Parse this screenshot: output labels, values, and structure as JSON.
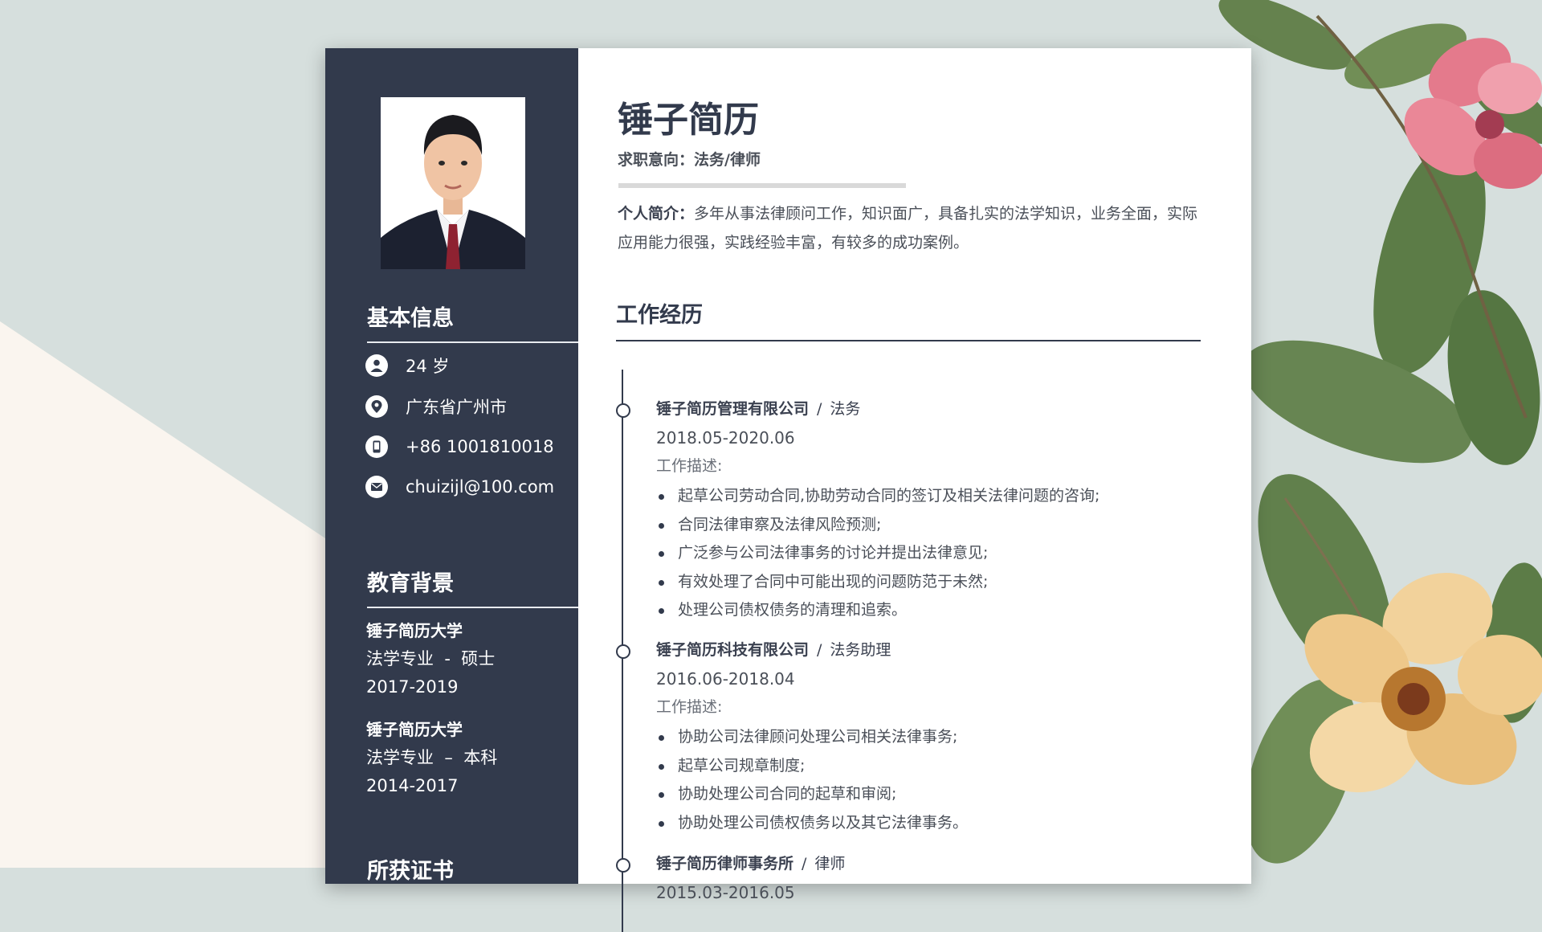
{
  "profile": {
    "name": "锤子简历",
    "intention": "求职意向：法务/律师",
    "summary_label": "个人简介：",
    "summary_text": "多年从事法律顾问工作，知识面广，具备扎实的法学知识，业务全面，实际应用能力很强，实践经验丰富，有较多的成功案例。"
  },
  "sidebar": {
    "basic_heading": "基本信息",
    "basic": [
      {
        "icon": "user-icon",
        "text": "24 岁"
      },
      {
        "icon": "location-pin-icon",
        "text": "广东省广州市"
      },
      {
        "icon": "phone-icon",
        "text": "+86 1001810018"
      },
      {
        "icon": "mail-icon",
        "text": "chuizijl@100.com"
      }
    ],
    "education_heading": "教育背景",
    "education": [
      {
        "school": "锤子简历大学",
        "major": "法学专业  -  硕士",
        "years": "2017-2019"
      },
      {
        "school": "锤子简历大学",
        "major": "法学专业  –  本科",
        "years": "2014-2017"
      }
    ],
    "certificates_heading": "所获证书"
  },
  "work": {
    "heading": "工作经历",
    "jobs": [
      {
        "company": "锤子简历管理有限公司",
        "role": "法务",
        "period": "2018.05-2020.06",
        "desc_label": "工作描述:",
        "bullets": [
          "起草公司劳动合同,协助劳动合同的签订及相关法律问题的咨询;",
          "合同法律审察及法律风险预测;",
          "广泛参与公司法律事务的讨论并提出法律意见;",
          "有效处理了合同中可能出现的问题防范于未然;",
          "处理公司债权债务的清理和追索。"
        ]
      },
      {
        "company": "锤子简历科技有限公司",
        "role": "法务助理",
        "period": "2016.06-2018.04",
        "desc_label": "工作描述:",
        "bullets": [
          "协助公司法律顾问处理公司相关法律事务;",
          "起草公司规章制度;",
          "协助处理公司合同的起草和审阅;",
          "协助处理公司债权债务以及其它法律事务。"
        ]
      },
      {
        "company": "锤子简历律师事务所",
        "role": "律师",
        "period": "2015.03-2016.05"
      }
    ]
  },
  "colors": {
    "sidebar": "#323a4c",
    "background": "#d6dfdd"
  }
}
